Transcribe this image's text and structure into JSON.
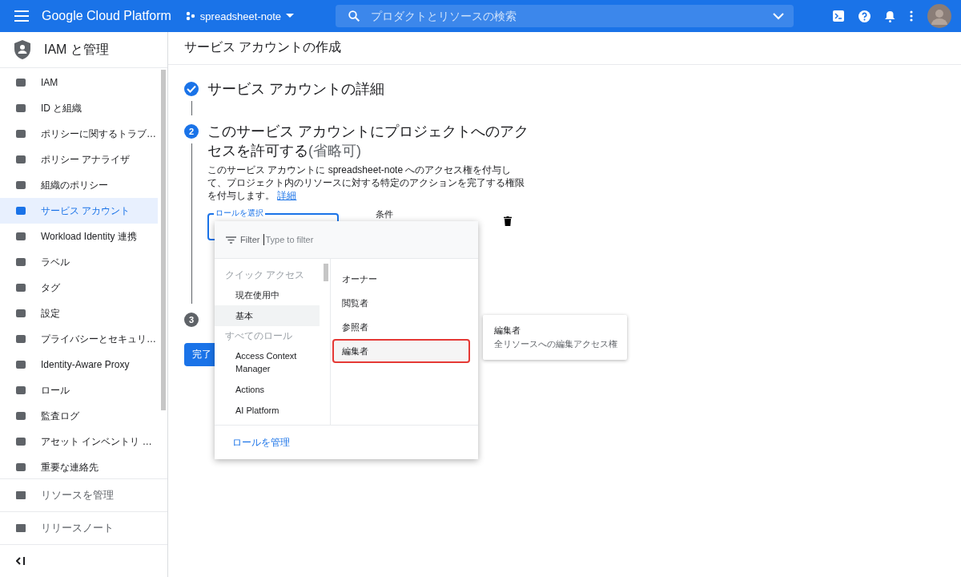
{
  "topbar": {
    "product": "Google Cloud Platform",
    "project": "spreadsheet-note",
    "search": {
      "placeholder": "プロダクトとリソースの検索"
    }
  },
  "sidebar": {
    "title": "IAM と管理",
    "items": [
      {
        "label": "IAM",
        "selected": false
      },
      {
        "label": "ID と組織",
        "selected": false
      },
      {
        "label": "ポリシーに関するトラブ…",
        "selected": false
      },
      {
        "label": "ポリシー アナライザ",
        "selected": false
      },
      {
        "label": "組織のポリシー",
        "selected": false
      },
      {
        "label": "サービス アカウント",
        "selected": true
      },
      {
        "label": "Workload Identity 連携",
        "selected": false
      },
      {
        "label": "ラベル",
        "selected": false
      },
      {
        "label": "タグ",
        "selected": false
      },
      {
        "label": "設定",
        "selected": false
      },
      {
        "label": "プライバシーとセキュリ…",
        "selected": false
      },
      {
        "label": "Identity-Aware Proxy",
        "selected": false
      },
      {
        "label": "ロール",
        "selected": false
      },
      {
        "label": "監査ログ",
        "selected": false
      },
      {
        "label": "アセット インベントリ …",
        "selected": false
      },
      {
        "label": "重要な連絡先",
        "selected": false
      }
    ],
    "footer": [
      {
        "label": "リソースを管理"
      },
      {
        "label": "リリースノート"
      }
    ]
  },
  "page": {
    "title": "サービス アカウントの作成",
    "steps": [
      {
        "completed": true,
        "active": false,
        "title": "サービス アカウントの詳細"
      },
      {
        "completed": false,
        "active": true,
        "number": "2",
        "title": "このサービス アカウントにプロジェクトへのアクセスを許可する",
        "optional": "(省略可)",
        "description": "このサービス アカウントに spreadsheet-note へのアクセス権を付与して、プロジェクト内のリソースに対する特定のアクションを完了する権限を付与します。",
        "link": "詳細"
      },
      {
        "completed": false,
        "active": false,
        "number": "3"
      }
    ],
    "role_field": {
      "label": "ロールを選択"
    },
    "condition_label": "条件",
    "done_button": "完了"
  },
  "role_menu": {
    "filter_label": "Filter",
    "placeholder": "Type to filter",
    "categories": [
      {
        "kind": "heading",
        "label": "クイック アクセス"
      },
      {
        "kind": "item",
        "label": "現在使用中",
        "selected": false
      },
      {
        "kind": "item",
        "label": "基本",
        "selected": true
      },
      {
        "kind": "heading",
        "label": "すべてのロール"
      },
      {
        "kind": "item",
        "label": "Access Context Manager",
        "selected": false
      },
      {
        "kind": "item",
        "label": "Actions",
        "selected": false
      },
      {
        "kind": "item",
        "label": "AI Platform",
        "selected": false
      }
    ],
    "roles": [
      {
        "label": "オーナー",
        "highlighted": false
      },
      {
        "label": "閲覧者",
        "highlighted": false
      },
      {
        "label": "参照者",
        "highlighted": false
      },
      {
        "label": "編集者",
        "highlighted": true
      }
    ],
    "manage_link": "ロールを管理"
  },
  "tooltip": {
    "title": "編集者",
    "description": "全リソースへの編集アクセス権"
  }
}
